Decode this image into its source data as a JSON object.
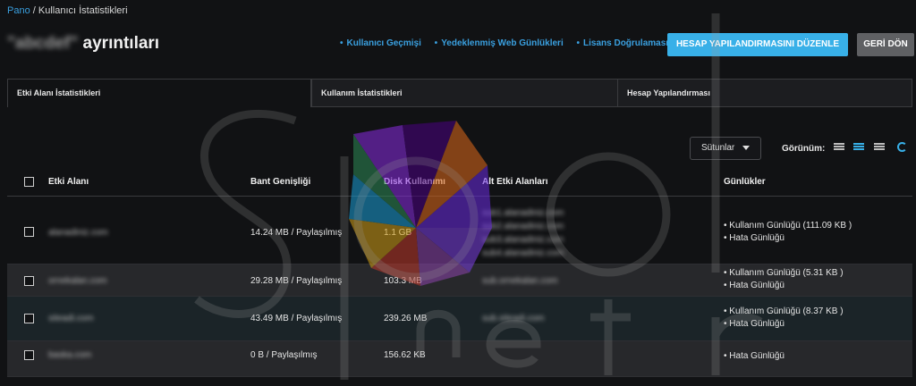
{
  "breadcrumb": {
    "home": "Pano",
    "separator": " / ",
    "current": "Kullanıcı İstatistikleri"
  },
  "page": {
    "username": "\"abcdef\"",
    "title_suffix": " ayrıntıları"
  },
  "links": [
    "Kullanıcı Geçmişi",
    "Yedeklenmiş Web Günlükleri",
    "Lisans Doğrulaması"
  ],
  "buttons": {
    "edit": "HESAP YAPILANDIRMASINI DÜZENLE",
    "back": "GERİ DÖN"
  },
  "tabs": [
    "Etki Alanı İstatistikleri",
    "Kullanım İstatistikleri",
    "Hesap Yapılandırması"
  ],
  "toolbar": {
    "columns": "Sütunlar",
    "view_label": "Görünüm:"
  },
  "columns": [
    "Etki Alanı",
    "Bant Genişliği",
    "Disk Kullanımı",
    "Alt Etki Alanları",
    "Günlükler"
  ],
  "rows": [
    {
      "domain": "alanadiniz.com",
      "bandwidth": "14.24 MB / Paylaşılmış",
      "disk": "1.1 GB",
      "subdomains": [
        "sub1.alanadiniz.com",
        "sub2.alanadiniz.com",
        "sub3.alanadiniz.com",
        "sub4.alanadiniz.com"
      ],
      "logs": [
        "• Kullanım Günlüğü (111.09 KB )",
        "• Hata Günlüğü"
      ]
    },
    {
      "domain": "ornekalan.com",
      "bandwidth": "29.28 MB / Paylaşılmış",
      "disk": "103.3 MB",
      "subdomains": [
        "sub.ornekalan.com"
      ],
      "logs": [
        "• Kullanım Günlüğü (5.31 KB )",
        "• Hata Günlüğü"
      ]
    },
    {
      "domain": "siteadi.com",
      "bandwidth": "43.49 MB / Paylaşılmış",
      "disk": "239.26 MB",
      "subdomains": [
        "sub.siteadi.com"
      ],
      "logs": [
        "• Kullanım Günlüğü (8.37 KB )",
        "• Hata Günlüğü"
      ]
    },
    {
      "domain": "baska.com",
      "bandwidth": "0 B / Paylaşılmış",
      "disk": "156.62 KB",
      "subdomains": [],
      "logs": [
        "• Hata Günlüğü"
      ]
    }
  ],
  "colors": {
    "accent": "#38b0e8",
    "link": "#3aa0e0",
    "background": "#111214"
  }
}
